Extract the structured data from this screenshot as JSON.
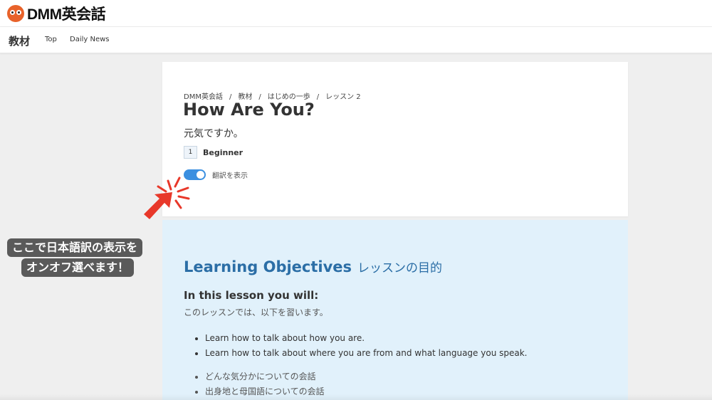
{
  "header": {
    "logo_text": "DMM英会話"
  },
  "subnav": {
    "title": "教材",
    "links": [
      "Top",
      "Daily News"
    ]
  },
  "lesson": {
    "breadcrumb": [
      "DMM英会話",
      "教材",
      "はじめの一歩",
      "レッスン 2"
    ],
    "breadcrumb_separator": "/",
    "title": "How Are You?",
    "subtitle": "元気ですか。",
    "level_number": "1",
    "level_label": "Beginner",
    "translation_toggle_label": "翻訳を表示",
    "translation_toggle_on": true
  },
  "objectives": {
    "title_en": "Learning Objectives",
    "title_ja": "レッスンの目的",
    "intro_en": "In this lesson you will:",
    "intro_ja": "このレッスンでは、以下を習います。",
    "items_en": [
      "Learn how to talk about how you are.",
      "Learn how to talk about where you are from and what language you speak."
    ],
    "items_ja": [
      "どんな気分かについての会話",
      "出身地と母国語についての会話"
    ]
  },
  "callout": {
    "line1": "ここで日本語訳の表示を",
    "line2": "オンオフ選べます！"
  },
  "colors": {
    "accent_blue": "#2b6ea6",
    "toggle_blue": "#3b8fe0",
    "pointer_red": "#e8382a",
    "logo_orange": "#e8622a"
  },
  "icons": {
    "logo": "owl-logo-icon",
    "pointer": "click-pointer-arrow-icon"
  }
}
